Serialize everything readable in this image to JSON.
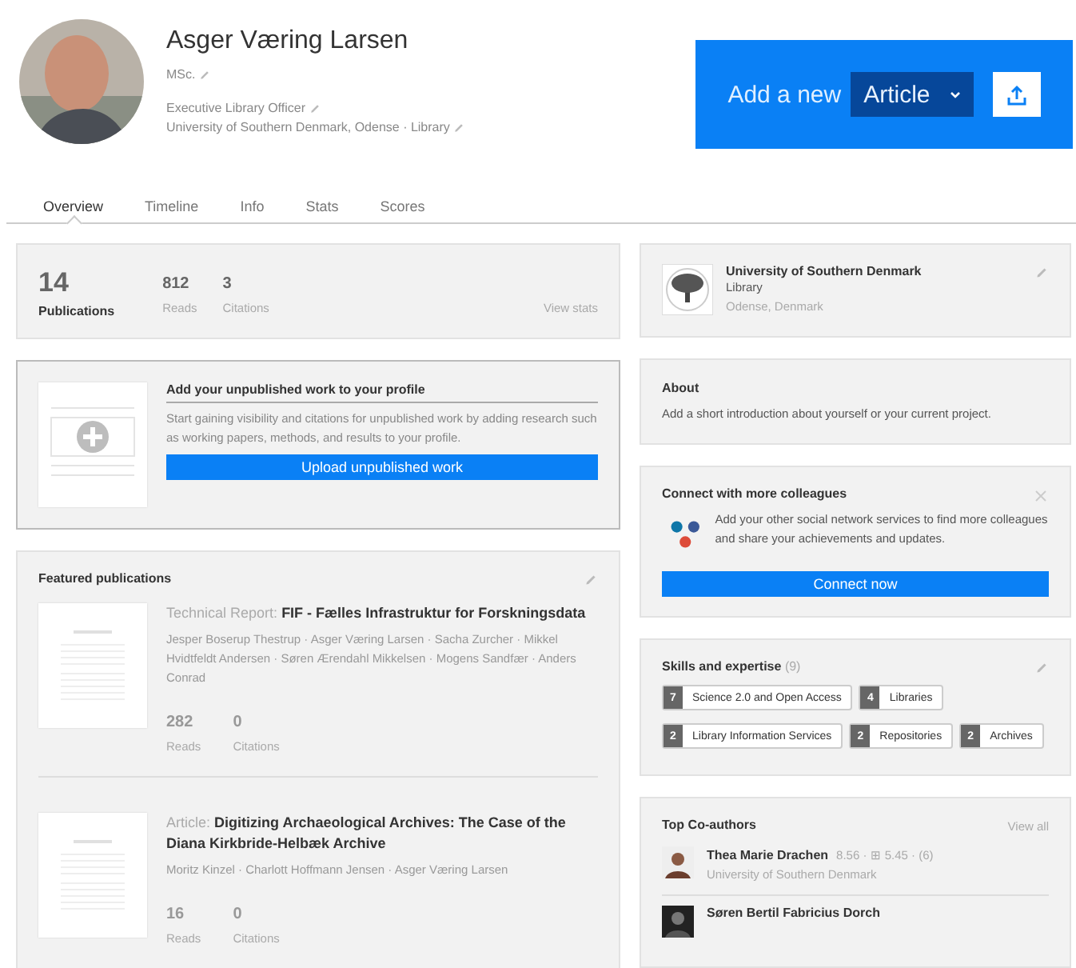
{
  "profile": {
    "name": "Asger Væring Larsen",
    "degree": "MSc.",
    "position": "Executive Library Officer",
    "affiliation": "University of Southern Denmark, Odense · Library"
  },
  "add_new": {
    "label": "Add a new",
    "type": "Article"
  },
  "tabs": [
    {
      "label": "Overview",
      "selected": true
    },
    {
      "label": "Timeline",
      "selected": false
    },
    {
      "label": "Info",
      "selected": false
    },
    {
      "label": "Stats",
      "selected": false
    },
    {
      "label": "Scores",
      "selected": false
    }
  ],
  "stats": {
    "publications": {
      "value": "14",
      "label": "Publications"
    },
    "items": [
      {
        "value": "812",
        "label": "Reads"
      },
      {
        "value": "3",
        "label": "Citations"
      }
    ],
    "link": "View stats"
  },
  "unpublished": {
    "title": "Add your unpublished work to your profile",
    "text": "Start gaining visibility and citations for unpublished work by adding research such as working papers, methods, and results to your profile.",
    "button": "Upload unpublished work"
  },
  "featured": {
    "title": "Featured publications",
    "items": [
      {
        "type": "Technical Report:",
        "title": "FIF - Fælles Infrastruktur for Forskningsdata",
        "authors": "Jesper Boserup Thestrup · Asger Væring Larsen · Sacha Zurcher · Mikkel Hvidtfeldt Andersen · Søren Ærendahl Mikkelsen · Mogens Sandfær · Anders Conrad",
        "reads": "282",
        "reads_label": "Reads",
        "citations": "0",
        "citations_label": "Citations"
      },
      {
        "type": "Article:",
        "title": "Digitizing Archaeological Archives: The Case of the Diana Kirkbride-Helbæk Archive",
        "authors": "Moritz Kinzel · Charlott Hoffmann Jensen · Asger Væring Larsen",
        "reads": "16",
        "reads_label": "Reads",
        "citations": "0",
        "citations_label": "Citations"
      }
    ]
  },
  "institution": {
    "name": "University of Southern Denmark",
    "department": "Library",
    "location": "Odense, Denmark"
  },
  "about": {
    "title": "About",
    "text": "Add a short introduction about yourself or your current project."
  },
  "connect": {
    "title": "Connect with more colleagues",
    "text": "Add your other social network services to find more colleagues and share your achievements and updates.",
    "button": "Connect now"
  },
  "skills": {
    "title": "Skills and expertise",
    "count": "(9)",
    "items": [
      {
        "count": "7",
        "label": "Science 2.0 and Open Access"
      },
      {
        "count": "4",
        "label": "Libraries"
      },
      {
        "count": "2",
        "label": "Library Information Services"
      },
      {
        "count": "2",
        "label": "Repositories"
      },
      {
        "count": "2",
        "label": "Archives"
      }
    ]
  },
  "coauthors": {
    "title": "Top Co-authors",
    "link": "View all",
    "items": [
      {
        "name": "Thea Marie Drachen",
        "stats": "8.56 · ⊞ 5.45 · (6)",
        "institution": "University of Southern Denmark"
      },
      {
        "name": "Søren Bertil Fabricius Dorch"
      }
    ]
  }
}
